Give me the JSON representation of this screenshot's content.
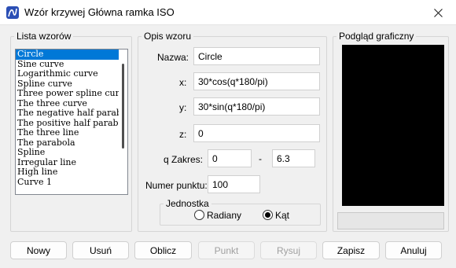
{
  "window": {
    "title": "Wzór krzywej Główna ramka ISO"
  },
  "patterns": {
    "legend": "Lista wzorów",
    "items": [
      "Circle",
      "Sine curve",
      "Logarithmic curve",
      "Spline curve",
      "Three power spline curve",
      "The three curve",
      "The negative half parabola",
      "The positive half parabola",
      "The three line",
      "The parabola",
      "Spline",
      "Irregular line",
      "High line",
      "Curve 1"
    ],
    "selected_index": 0
  },
  "description": {
    "legend": "Opis wzoru",
    "name_label": "Nazwa:",
    "name_value": "Circle",
    "x_label": "x:",
    "x_value": "30*cos(q*180/pi)",
    "y_label": "y:",
    "y_value": "30*sin(q*180/pi)",
    "z_label": "z:",
    "z_value": "0",
    "range_label": "q  Zakres:",
    "range_from": "0",
    "range_dash": "-",
    "range_to": "6.3",
    "points_label": "Numer punktu:",
    "points_value": "100",
    "unit": {
      "legend": "Jednostka",
      "radians_label": "Radiany",
      "degrees_label": "Kąt",
      "selected": "degrees"
    }
  },
  "preview": {
    "legend": "Podgląd graficzny"
  },
  "buttons": {
    "new": "Nowy",
    "delete": "Usuń",
    "calculate": "Oblicz",
    "point": "Punkt",
    "draw": "Rysuj",
    "save": "Zapisz",
    "cancel": "Anuluj"
  },
  "colors": {
    "selection": "#0078d7",
    "preview_bg": "#000000"
  }
}
